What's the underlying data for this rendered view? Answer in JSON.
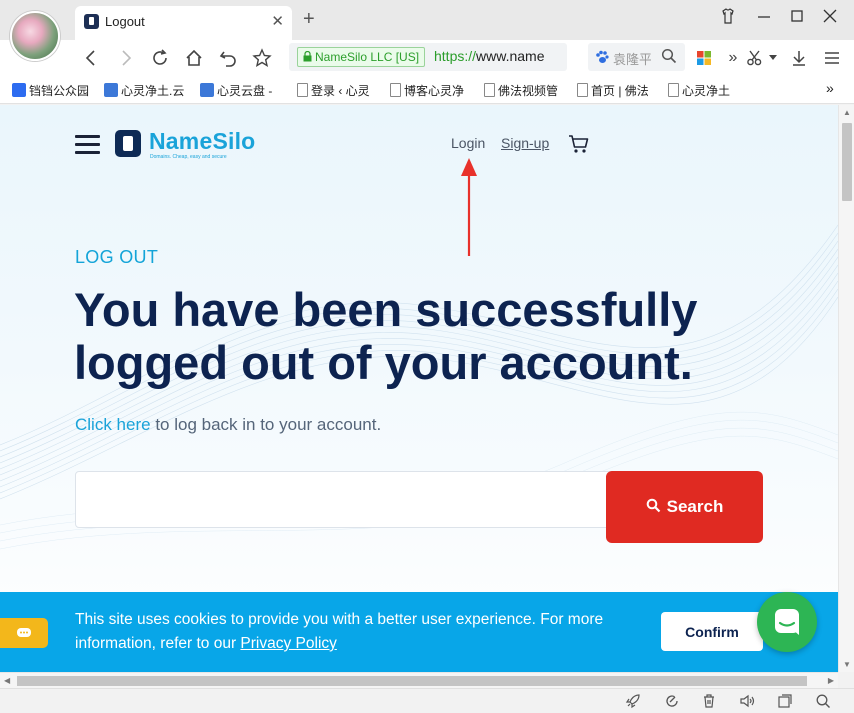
{
  "browser": {
    "tab_title": "Logout",
    "tab_close": "✕",
    "new_tab": "+",
    "secure_label": "NameSilo LLC [US]",
    "url_scheme": "https://",
    "url_host": "www.name",
    "search_placeholder": "袁隆平",
    "bookmarks": [
      "铛铛公众园",
      "心灵净土.云",
      "心灵云盘 -",
      "登录 ‹ 心灵",
      "博客心灵净",
      "佛法视频管",
      "首页 | 佛法",
      "心灵净土"
    ],
    "more_bookmarks": "»",
    "more_tools": "»"
  },
  "header": {
    "brand_name": "NameSilo",
    "brand_tagline": "Domains. Cheap, easy and secure",
    "login_label": "Login",
    "signup_label": "Sign-up"
  },
  "main": {
    "kicker": "LOG OUT",
    "headline": "You have been successfully logged out of your account.",
    "click_here": "Click here",
    "subline_rest": " to log back in to your account.",
    "search_value": "",
    "search_button": "Search"
  },
  "cookie": {
    "text_before": "This site uses cookies to provide you with a better user experience. For more information, refer to our ",
    "policy_link": "Privacy Policy",
    "confirm_label": "Confirm"
  },
  "colors": {
    "brand": "#1aa3d9",
    "navy": "#0d2350",
    "search_red": "#e02a22",
    "cookie_blue": "#08a6e8",
    "intercom_green": "#2db554",
    "annotation_red": "#e8312b"
  }
}
